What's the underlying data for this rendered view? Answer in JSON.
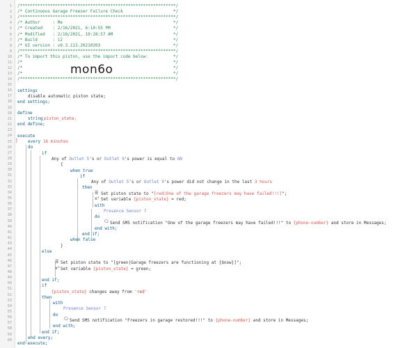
{
  "editor": {
    "lines": [
      {
        "n": "1",
        "t": "/**************************************************************/"
      },
      {
        "n": "2",
        "t": "/* Continuous Garage Freezer Failure Check                    */"
      },
      {
        "n": "3",
        "t": "/**************************************************************/"
      },
      {
        "n": "4",
        "t": "/* Author     : Me                                            */"
      },
      {
        "n": "5",
        "t": "/* Created    : 2/16/2021, 6:10:55 PM                         */"
      },
      {
        "n": "6",
        "t": "/* Modified   : 2/18/2021, 10:28:57 AM                        */"
      },
      {
        "n": "7",
        "t": "/* Build      : 12                                            */"
      },
      {
        "n": "8",
        "t": "/* UI version : v0.3.113.20210203                             */"
      },
      {
        "n": "9",
        "t": "/**************************************************************/"
      },
      {
        "n": "10",
        "t": "/* To import this piston, use the import code below:          */"
      },
      {
        "n": "11",
        "t": "/*                                                            */"
      },
      {
        "n": "12",
        "t": "/*                                                            */"
      },
      {
        "n": "13",
        "t": "/*                                                            */"
      },
      {
        "n": "14",
        "t": "/**************************************************************/"
      }
    ],
    "import_code": "mon6o",
    "line_numbers": [
      "15",
      "16",
      "17",
      "18",
      "19",
      "20",
      "21",
      "22",
      "23",
      "24",
      "25",
      "26",
      "27",
      "28",
      "29",
      "30",
      "31",
      "32",
      "33",
      "34",
      "35",
      "36",
      "37",
      "38",
      "39",
      "40",
      "41",
      "42",
      "43",
      "44",
      "45",
      "46",
      "47",
      "48",
      "49",
      "50",
      "51",
      "52",
      "53",
      "54",
      "55",
      "56",
      "57",
      "58",
      "59",
      "60"
    ],
    "code": {
      "settings": "settings",
      "disable_state": "disable automatic piston state;",
      "end_settings": "end settings;",
      "define": "define",
      "string_kw": "string",
      "piston_state_decl": "piston_state;",
      "end_define": "end define;",
      "execute": "execute",
      "every": "every",
      "every_value": "16 minutes",
      "do": "do",
      "if": "if",
      "any_of": "Any of",
      "outlet5": "Outlet 5",
      "s_or": "'s or",
      "outlet9": "Outlet 9",
      "s_power_equal": "'s power is equal to",
      "on": "ON",
      "brace_open": "{",
      "when_true": "when true",
      "if_inner": "if",
      "did_not_change": "'s power did not change in the last",
      "hours": "3 hours",
      "then": "then",
      "set_piston_state": "Set piston state to \"",
      "failed_state": "[red|One of the garage freezers may have failed!!!]",
      "close_quote_semi": "\";",
      "set_variable": "Set variable",
      "piston_state_var": "{piston_state}",
      "eq_red": "= red;",
      "with": "with",
      "presence_sensor": "Presence Sensor 7",
      "do_inner": "do",
      "send_sms": "Send SMS notification \"One of the garage freezers may have failed!!!\" to",
      "phone_number": "{phone-number}",
      "store_messages": "and store in Messages;",
      "end_with": "end with;",
      "end_if_inner": "end if;",
      "when_false": "when false",
      "brace_close": "}",
      "else": "else",
      "set_piston_state_green": "Set piston state to \"[green|Garage freezers are functioning at {$now}]\";",
      "set_variable_green": "Set variable",
      "eq_green": "= green;",
      "end_if": "end if;",
      "if2": "if",
      "changes_away": "changes away from",
      "red_str": "'red'",
      "then2": "then",
      "with2": "with",
      "presence_sensor2": "Presence Sensor 7",
      "do2": "do",
      "send_sms2": "Send SMS notification \"Freezers in garage restored!!!\" to",
      "phone_number2": "{phone-number}",
      "store_messages2": "and store in Messages;",
      "end_with2": "end with;",
      "end_if2": "end if;",
      "end_every": "end every;",
      "end_execute": "end execute;"
    }
  },
  "colors": {
    "comment": "#2e8b57",
    "keyword": "#0b5f88",
    "variable": "#d9534f",
    "device": "#6f7fd1"
  }
}
